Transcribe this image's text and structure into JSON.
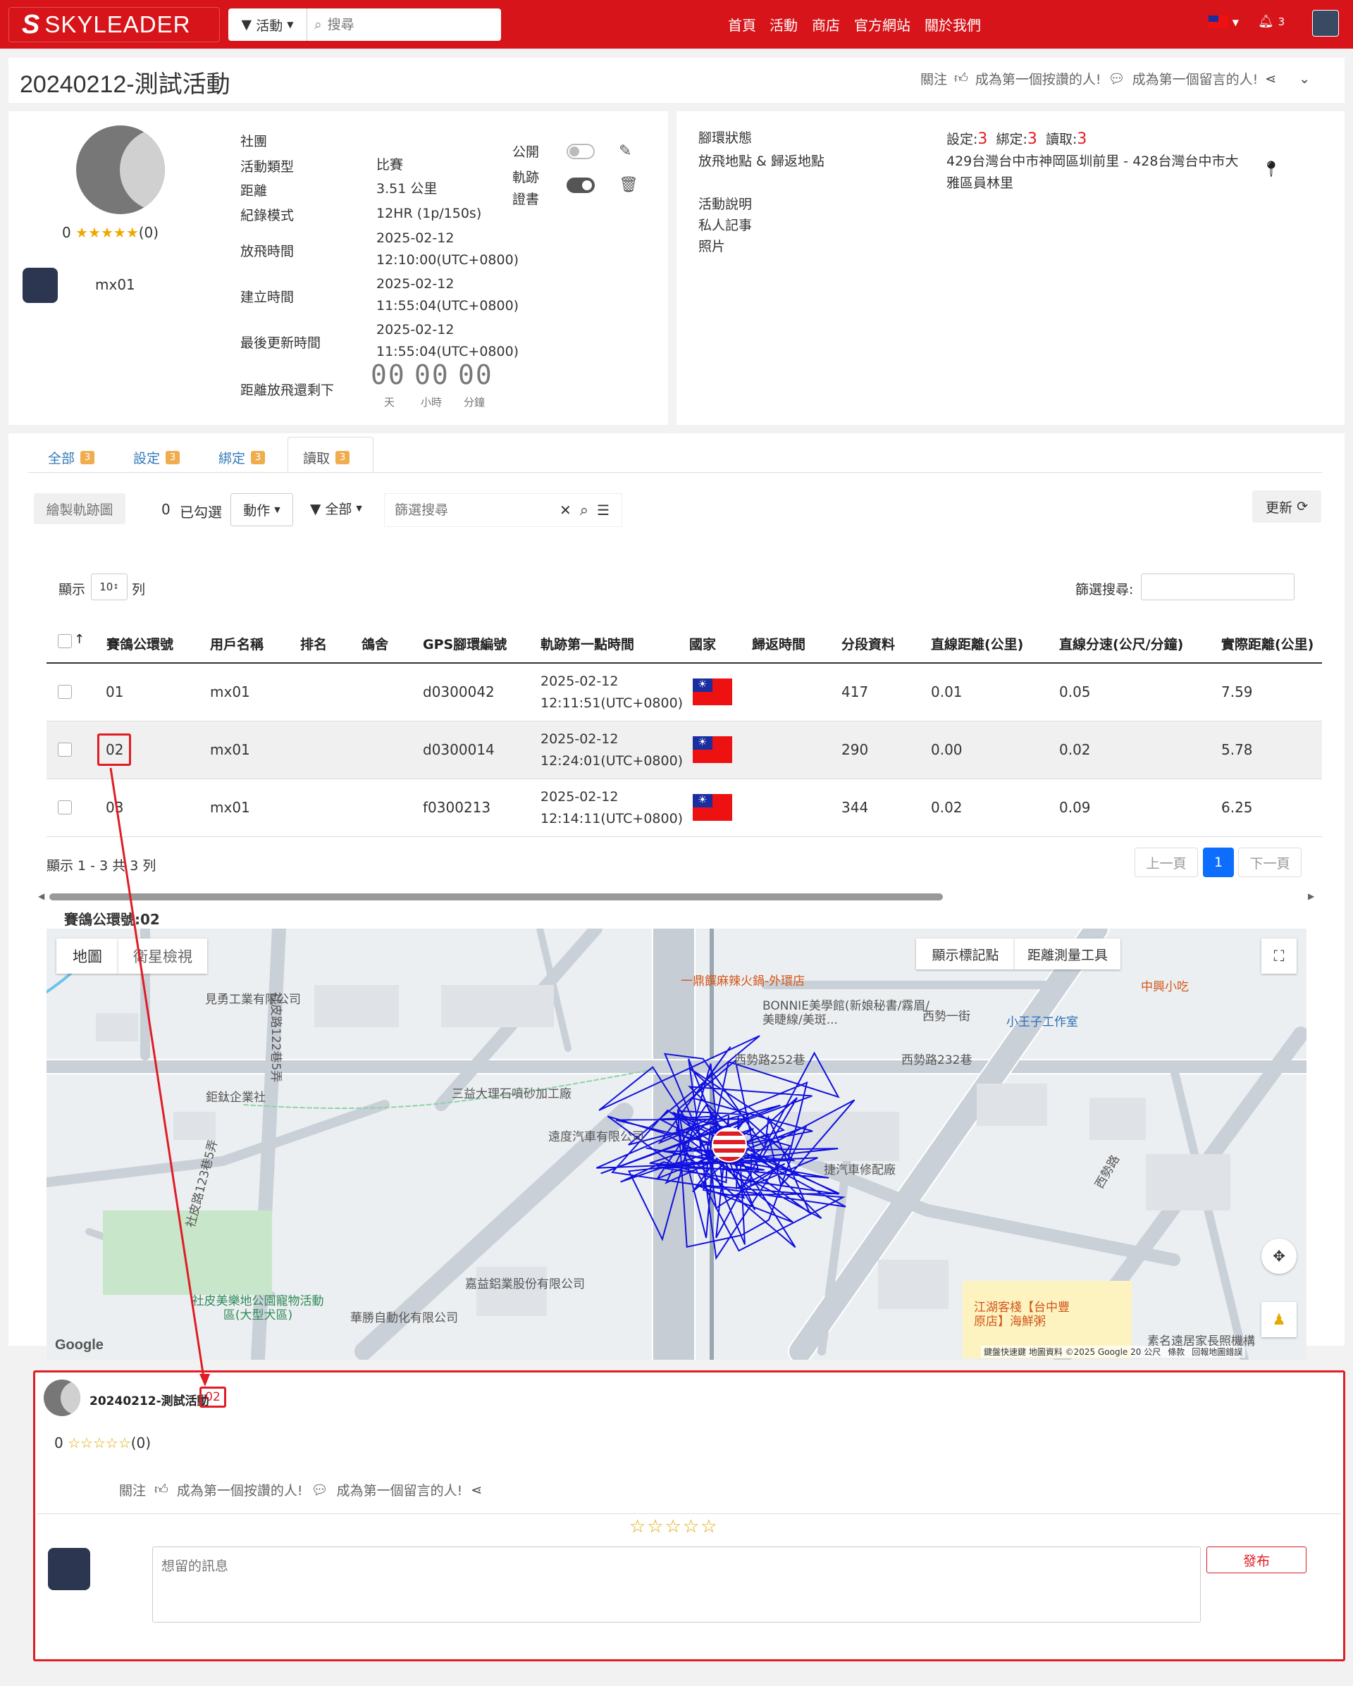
{
  "navbar": {
    "logo_text": "SKYLEADER",
    "filter_label": "活動",
    "search_placeholder": "搜尋",
    "links": [
      "首頁",
      "活動",
      "商店",
      "官方網站",
      "關於我們"
    ],
    "notification_count": "3"
  },
  "title": {
    "text": "20240212-測試活動",
    "follow": "關注",
    "like_text": "成為第一個按讚的人!",
    "comment_text": "成為第一個留言的人!"
  },
  "info": {
    "rating_value": "0",
    "rating_count": "(0)",
    "user_name": "mx01",
    "fields": [
      {
        "label": "社團",
        "value": ""
      },
      {
        "label": "活動類型",
        "value": "比賽"
      },
      {
        "label": "距離",
        "value": "3.51 公里"
      },
      {
        "label": "紀錄模式",
        "value": "12HR (1p/150s)"
      },
      {
        "label": "放飛時間",
        "value": "2025-02-12",
        "value2": "12:10:00(UTC+0800)"
      },
      {
        "label": "建立時間",
        "value": "2025-02-12",
        "value2": "11:55:04(UTC+0800)"
      },
      {
        "label": "最後更新時間",
        "value": "2025-02-12",
        "value2": "11:55:04(UTC+0800)"
      },
      {
        "label": "距離放飛還剩下",
        "value": ""
      }
    ],
    "public_label": "公開",
    "track_cert_label_1": "軌跡",
    "track_cert_label_2": "證書",
    "countdown": {
      "days": "00",
      "hours": "00",
      "minutes": "00",
      "days_label": "天",
      "hours_label": "小時",
      "minutes_label": "分鐘"
    }
  },
  "info_right": {
    "ring_status_label": "腳環狀態",
    "ring_set_label": "設定:",
    "ring_set_value": "3",
    "ring_bound_label": "綁定:",
    "ring_bound_value": "3",
    "ring_read_label": "讀取:",
    "ring_read_value": "3",
    "release_return_label": "放飛地點 & 歸返地點",
    "release_return_value_1": "429台灣台中市神岡區圳前里 - 428台灣台中市大",
    "release_return_value_2": "雅區員林里",
    "desc_label": "活動說明",
    "notes_label": "私人記事",
    "photos_label": "照片"
  },
  "tabs": [
    {
      "label": "全部",
      "count": "3"
    },
    {
      "label": "設定",
      "count": "3"
    },
    {
      "label": "綁定",
      "count": "3"
    },
    {
      "label": "讀取",
      "count": "3"
    }
  ],
  "toolbar": {
    "draw_track": "繪製軌跡圖",
    "selected_count": "0",
    "selected_label": "已勾選",
    "action_label": "動作",
    "filter_all": "全部",
    "filter_placeholder": "篩選搜尋",
    "refresh_label": "更新"
  },
  "table_controls": {
    "show_label": "顯示",
    "page_size": "10",
    "rows_label": "列",
    "filter_search_label": "篩選搜尋:"
  },
  "table": {
    "headers": [
      "賽鴿公環號",
      "用戶名稱",
      "排名",
      "鴿舍",
      "GPS腳環編號",
      "軌跡第一點時間",
      "國家",
      "歸返時間",
      "分段資料",
      "直線距離(公里)",
      "直線分速(公尺/分鐘)",
      "實際距離(公里)"
    ],
    "rows": [
      {
        "ring": "01",
        "user": "mx01",
        "gps": "d0300042",
        "time_date": "2025-02-12",
        "time_clock": "12:11:51(UTC+0800)",
        "segments": "417",
        "dist": "0.01",
        "speed": "0.05",
        "actual": "7.59"
      },
      {
        "ring": "02",
        "user": "mx01",
        "gps": "d0300014",
        "time_date": "2025-02-12",
        "time_clock": "12:24:01(UTC+0800)",
        "segments": "290",
        "dist": "0.00",
        "speed": "0.02",
        "actual": "5.78"
      },
      {
        "ring": "03",
        "user": "mx01",
        "gps": "f0300213",
        "time_date": "2025-02-12",
        "time_clock": "12:14:11(UTC+0800)",
        "segments": "344",
        "dist": "0.02",
        "speed": "0.09",
        "actual": "6.25"
      }
    ],
    "summary": "顯示 1 - 3 共 3 列"
  },
  "pagination": {
    "prev": "上一頁",
    "current": "1",
    "next": "下一頁"
  },
  "map": {
    "title": "賽鴿公環號:02",
    "btn_map": "地圖",
    "btn_satellite": "衛星檢視",
    "btn_markers": "顯示標記點",
    "btn_measure": "距離測量工具",
    "google_text": "Google",
    "footer": "鍵盤快速鍵  地圖資料 ©2025 Google  20 公尺",
    "footer_terms": "條款",
    "footer_report": "回報地圖錯誤",
    "labels": [
      "見勇工業有限公司",
      "鉅鈦企業社",
      "三益大理石噴砂加工廠",
      "遠度汽車有限公司",
      "捷汽車修配廠",
      "嘉益鋁業股份有限公司",
      "華勝自動化有限公司",
      "社皮美樂地公園寵物活動區(大型犬區)",
      "素名遠居家長照機構",
      "西勢路252巷",
      "西勢路232巷",
      "西勢一街",
      "BONNIE美學館(新娘秘書/霧眉/美睫線/美斑...",
      "小王子工作室",
      "社皮路122巷5弄",
      "社皮路123巷5弄",
      "西勢路"
    ],
    "orange_labels": [
      "一鼎饌麻辣火鍋-外環店",
      "中興小吃",
      "江湖客棧【台中豐原店】海鮮粥"
    ]
  },
  "comment": {
    "title": "20240212-測試活動",
    "ring_tag": "02",
    "rating_value": "0",
    "rating_count": "(0)",
    "follow": "關注",
    "like_text": "成為第一個按讚的人!",
    "comment_text": "成為第一個留言的人!",
    "placeholder": "想留的訊息",
    "post_label": "發布"
  },
  "colors": {
    "brand": "#d7141a",
    "annotation_red": "#e01c24",
    "track_blue": "#1010e0",
    "primary_blue": "#0d6efd",
    "star_gold": "#f0a800"
  }
}
